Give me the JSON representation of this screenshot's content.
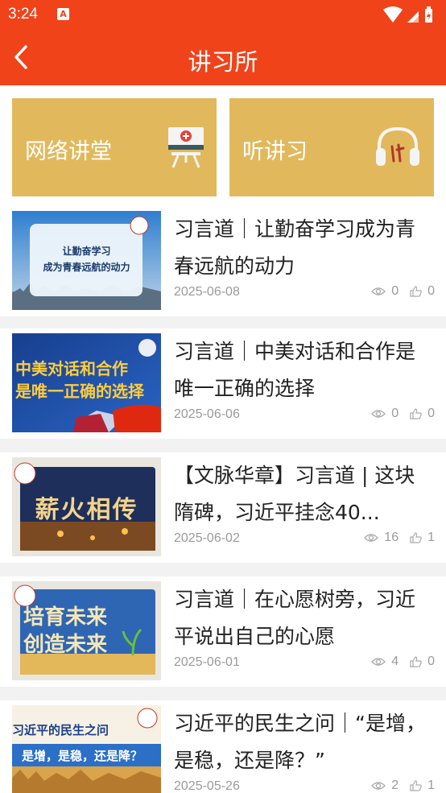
{
  "status_bar": {
    "time": "3:24",
    "notification_glyph": "A"
  },
  "app_bar": {
    "title": "讲习所"
  },
  "tiles": [
    {
      "label": "网络讲堂",
      "icon": "classroom-board-icon"
    },
    {
      "label": "听讲习",
      "icon": "headphones-icon"
    }
  ],
  "articles": [
    {
      "title": "习言道｜让勤奋学习成为青春远航的动力",
      "date": "2025-06-08",
      "views": "0",
      "likes": "0",
      "thumb_text": [
        "让勤奋学习",
        "成为青春远航的动力"
      ]
    },
    {
      "title": "习言道｜中美对话和合作是唯一正确的选择",
      "date": "2025-06-06",
      "views": "0",
      "likes": "0",
      "thumb_text": [
        "中美对话和合作",
        "是唯一正确的选择"
      ]
    },
    {
      "title": "【文脉华章】习言道 | 这块隋碑，习近平挂念40...",
      "date": "2025-06-02",
      "views": "16",
      "likes": "1",
      "thumb_text": [
        "薪火相传"
      ]
    },
    {
      "title": "习言道｜在心愿树旁，习近平说出自己的心愿",
      "date": "2025-06-01",
      "views": "4",
      "likes": "0",
      "thumb_text": [
        "培育未来",
        "创造未来"
      ]
    },
    {
      "title": "习近平的民生之问｜“是增，是稳，还是降？”",
      "date": "2025-05-26",
      "views": "2",
      "likes": "1",
      "thumb_text": [
        "习近平的民生之问",
        "是增，是稳，还是降？"
      ]
    }
  ],
  "colors": {
    "accent": "#f0431a",
    "tile": "#e1b95c"
  }
}
